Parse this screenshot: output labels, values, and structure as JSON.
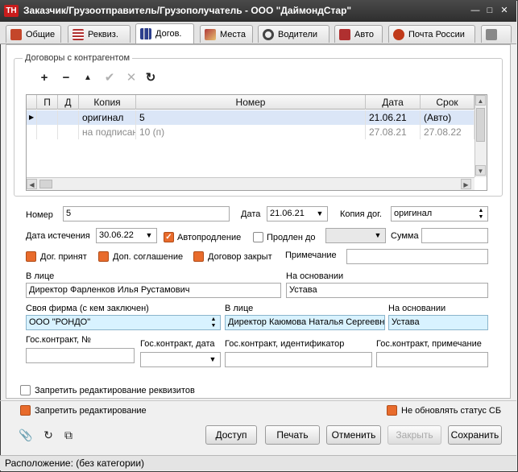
{
  "window": {
    "icon_text": "TH",
    "title": "Заказчик/Грузоотправитель/Грузополучатель - ООО \"ДаймондСтар\"",
    "colors": {
      "titlebar": "#2e2e2e",
      "accent_orange": "#e86b2c",
      "highlight_blue": "#d8f2ff",
      "selected_row": "#dbe6f7"
    }
  },
  "tabs": [
    {
      "label": "Общие",
      "icon": "home-icon"
    },
    {
      "label": "Реквиз.",
      "icon": "list-icon"
    },
    {
      "label": "Догов.",
      "icon": "binders-icon",
      "active": true
    },
    {
      "label": "Места",
      "icon": "map-icon"
    },
    {
      "label": "Водители",
      "icon": "steering-wheel-icon"
    },
    {
      "label": "Авто",
      "icon": "truck-icon"
    },
    {
      "label": "Почта России",
      "icon": "post-icon"
    }
  ],
  "contracts": {
    "group_title": "Договоры с контрагентом",
    "columns": [
      "П",
      "Д",
      "Копия",
      "Номер",
      "Дата",
      "Срок"
    ],
    "rows": [
      {
        "copy": "оригинал",
        "number": "5",
        "date": "21.06.21",
        "term": "(Авто)",
        "selected": true
      },
      {
        "copy": "на подписан",
        "number": "10 (п)",
        "date": "27.08.21",
        "term": "27.08.22",
        "muted": true
      }
    ]
  },
  "form": {
    "number_label": "Номер",
    "number_value": "5",
    "date_label": "Дата",
    "date_value": "21.06.21",
    "copy_label": "Копия дог.",
    "copy_value": "оригинал",
    "expiry_label": "Дата истечения",
    "expiry_value": "30.06.22",
    "auto_extend_label": "Автопродление",
    "extended_to_label": "Продлен до",
    "extended_to_value": "",
    "sum_label": "Сумма",
    "sum_value": "",
    "accepted_label": "Дог. принят",
    "addendum_label": "Доп. соглашение",
    "closed_label": "Договор закрыт",
    "note_label": "Примечание",
    "note_value": "",
    "person_label": "В лице",
    "person_value": "Директор Фарленков Илья Рустамович",
    "basis_label": "На основании",
    "basis_value": "Устава",
    "own_firm_label": "Своя фирма (с кем заключен)",
    "own_firm_value": "ООО \"РОНДО\"",
    "own_person_label": "В лице",
    "own_person_value": "Директор Каюмова Наталья Сергеевна",
    "own_basis_label": "На основании",
    "own_basis_value": "Устава",
    "gov_number_label": "Гос.контракт, №",
    "gov_number_value": "",
    "gov_date_label": "Гос.контракт, дата",
    "gov_date_value": "",
    "gov_id_label": "Гос.контракт, идентификатор",
    "gov_id_value": "",
    "gov_note_label": "Гос.контракт, примечание",
    "gov_note_value": ""
  },
  "options": {
    "forbid_requisites_label": "Запретить редактирование реквизитов",
    "forbid_edit_label": "Запретить редактирование",
    "no_sb_status_label": "Не обновлять статус СБ"
  },
  "buttons": {
    "access": "Доступ",
    "print": "Печать",
    "cancel": "Отменить",
    "close": "Закрыть",
    "save": "Сохранить"
  },
  "status": {
    "text": "Расположение: (без категории)"
  }
}
